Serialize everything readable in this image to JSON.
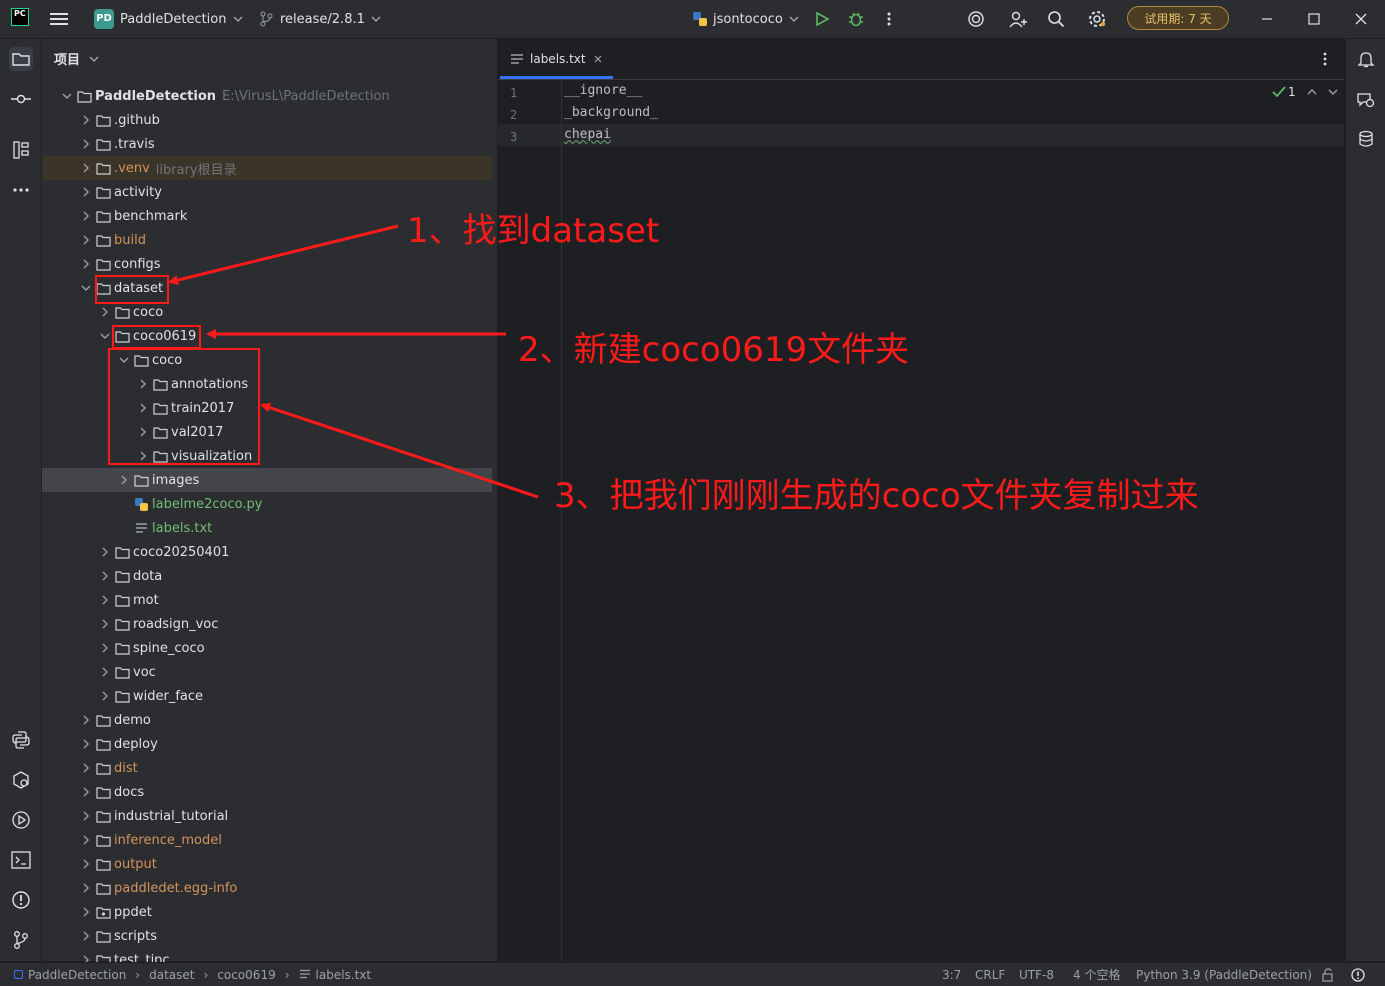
{
  "titlebar": {
    "logo_text": "PC",
    "project_badge": "PD",
    "project_name": "PaddleDetection",
    "branch": "release/2.8.1",
    "run_config": "jsontococo",
    "trial": "试用期: 7 天"
  },
  "project_panel": {
    "header": "项目",
    "tree": [
      {
        "label": "PaddleDetection",
        "hint": "E:\\VirusL\\PaddleDetection",
        "level": 0,
        "expanded": true,
        "type": "folder",
        "bold": true
      },
      {
        "label": ".github",
        "level": 1,
        "expanded": false,
        "type": "folder"
      },
      {
        "label": ".travis",
        "level": 1,
        "expanded": false,
        "type": "folder"
      },
      {
        "label": ".venv",
        "hint": "library根目录",
        "level": 1,
        "expanded": false,
        "type": "folder",
        "color": "orange",
        "venv": true
      },
      {
        "label": "activity",
        "level": 1,
        "expanded": false,
        "type": "folder"
      },
      {
        "label": "benchmark",
        "level": 1,
        "expanded": false,
        "type": "folder"
      },
      {
        "label": "build",
        "level": 1,
        "expanded": false,
        "type": "folder",
        "color": "orange"
      },
      {
        "label": "configs",
        "level": 1,
        "expanded": false,
        "type": "folder"
      },
      {
        "label": "dataset",
        "level": 1,
        "expanded": true,
        "type": "folder"
      },
      {
        "label": "coco",
        "level": 2,
        "expanded": false,
        "type": "folder"
      },
      {
        "label": "coco0619",
        "level": 2,
        "expanded": true,
        "type": "folder"
      },
      {
        "label": "coco",
        "level": 3,
        "expanded": true,
        "type": "folder"
      },
      {
        "label": "annotations",
        "level": 4,
        "expanded": false,
        "type": "folder"
      },
      {
        "label": "train2017",
        "level": 4,
        "expanded": false,
        "type": "folder"
      },
      {
        "label": "val2017",
        "level": 4,
        "expanded": false,
        "type": "folder"
      },
      {
        "label": "visualization",
        "level": 4,
        "expanded": false,
        "type": "folder"
      },
      {
        "label": "images",
        "level": 3,
        "expanded": false,
        "type": "folder",
        "selected": true
      },
      {
        "label": "labelme2coco.py",
        "level": 3,
        "type": "python",
        "color": "green"
      },
      {
        "label": "labels.txt",
        "level": 3,
        "type": "text",
        "color": "green"
      },
      {
        "label": "coco20250401",
        "level": 2,
        "expanded": false,
        "type": "folder"
      },
      {
        "label": "dota",
        "level": 2,
        "expanded": false,
        "type": "folder"
      },
      {
        "label": "mot",
        "level": 2,
        "expanded": false,
        "type": "folder"
      },
      {
        "label": "roadsign_voc",
        "level": 2,
        "expanded": false,
        "type": "folder"
      },
      {
        "label": "spine_coco",
        "level": 2,
        "expanded": false,
        "type": "folder"
      },
      {
        "label": "voc",
        "level": 2,
        "expanded": false,
        "type": "folder"
      },
      {
        "label": "wider_face",
        "level": 2,
        "expanded": false,
        "type": "folder"
      },
      {
        "label": "demo",
        "level": 1,
        "expanded": false,
        "type": "folder"
      },
      {
        "label": "deploy",
        "level": 1,
        "expanded": false,
        "type": "folder"
      },
      {
        "label": "dist",
        "level": 1,
        "expanded": false,
        "type": "folder",
        "color": "orange"
      },
      {
        "label": "docs",
        "level": 1,
        "expanded": false,
        "type": "folder"
      },
      {
        "label": "industrial_tutorial",
        "level": 1,
        "expanded": false,
        "type": "folder"
      },
      {
        "label": "inference_model",
        "level": 1,
        "expanded": false,
        "type": "folder",
        "color": "orange"
      },
      {
        "label": "output",
        "level": 1,
        "expanded": false,
        "type": "folder",
        "color": "orange"
      },
      {
        "label": "paddledet.egg-info",
        "level": 1,
        "expanded": false,
        "type": "folder",
        "color": "orange"
      },
      {
        "label": "ppdet",
        "level": 1,
        "expanded": false,
        "type": "package"
      },
      {
        "label": "scripts",
        "level": 1,
        "expanded": false,
        "type": "folder"
      },
      {
        "label": "test_tipc",
        "level": 1,
        "expanded": false,
        "type": "folder"
      }
    ]
  },
  "editor": {
    "tab_label": "labels.txt",
    "inspection_count": "1",
    "lines": [
      {
        "num": "1",
        "text": "__ignore__"
      },
      {
        "num": "2",
        "text": "_background_"
      },
      {
        "num": "3",
        "text": "chepai"
      }
    ]
  },
  "statusbar": {
    "breadcrumb": [
      "PaddleDetection",
      "dataset",
      "coco0619",
      "labels.txt"
    ],
    "position": "3:7",
    "line_sep": "CRLF",
    "encoding": "UTF-8",
    "indent": "4 个空格",
    "interpreter": "Python 3.9 (PaddleDetection)"
  },
  "annotations": {
    "step1": "1、找到dataset",
    "step2": "2、新建coco0619文件夹",
    "step3": "3、把我们刚刚生成的coco文件夹复制过来"
  },
  "colors": {
    "accent": "#3574f0",
    "annotation_red": "#ff1a1a",
    "excluded_orange": "#d5935b",
    "new_file_green": "#73bd79"
  }
}
